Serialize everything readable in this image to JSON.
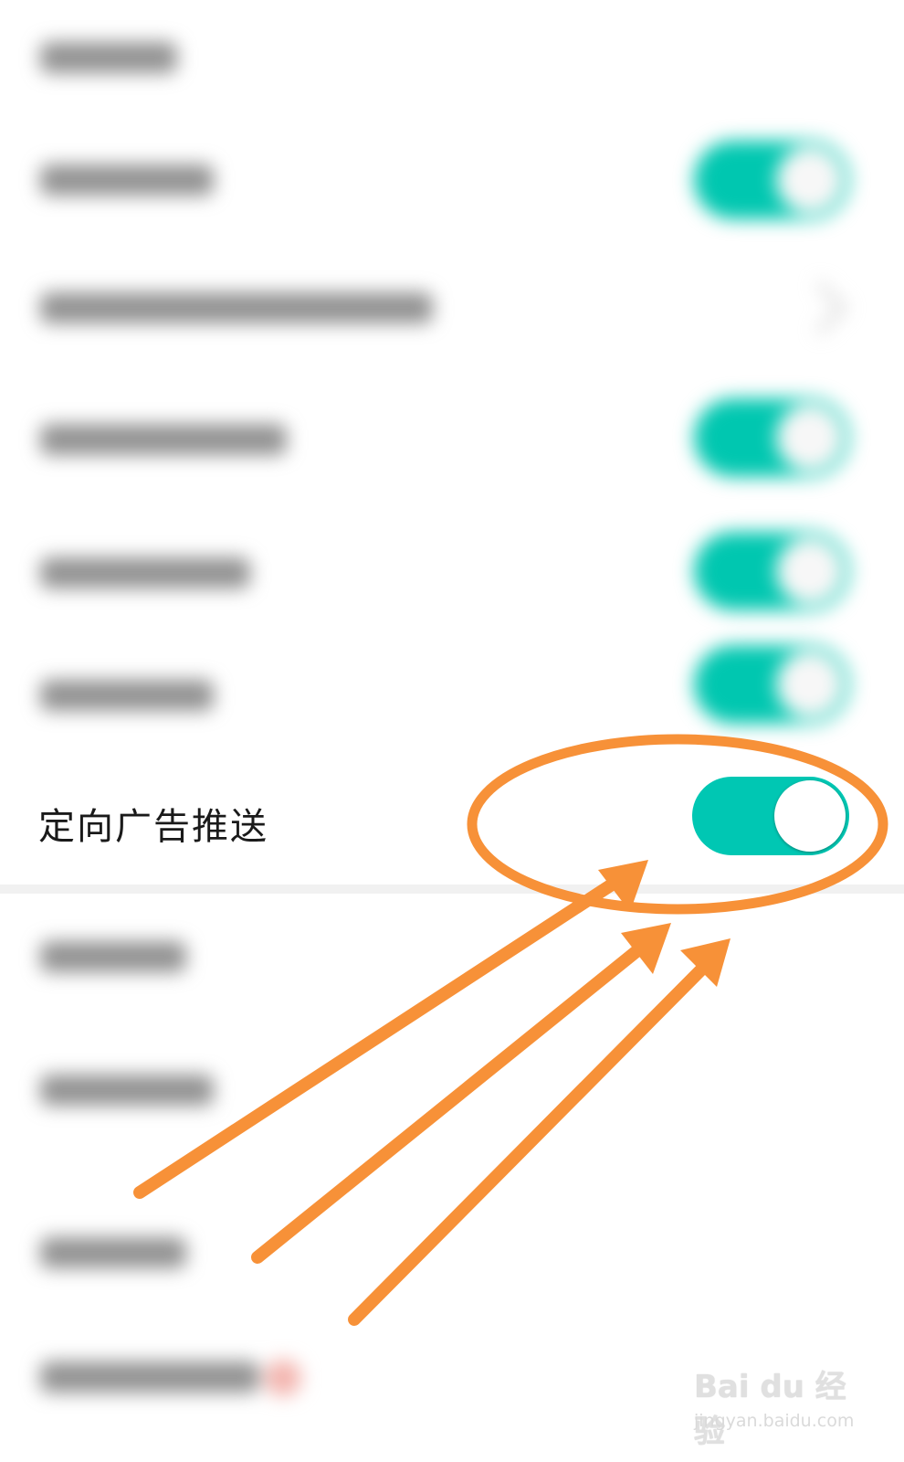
{
  "settings": {
    "ad_push": {
      "label": "定向广告推送",
      "enabled": true,
      "toggle_color": "#00c7b3"
    }
  },
  "annotation": {
    "color": "#f79138"
  },
  "watermark": {
    "brand": "Bai du 经验",
    "url": "jingyan.baidu.com"
  }
}
